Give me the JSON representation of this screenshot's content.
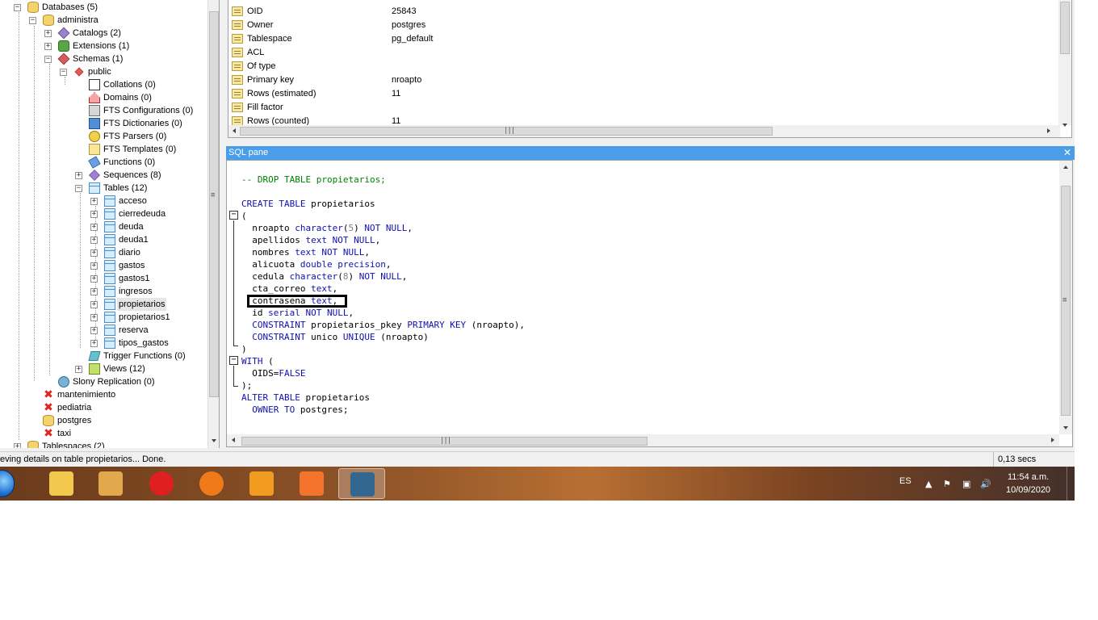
{
  "tree": {
    "databases": "Databases (5)",
    "administra": "administra",
    "catalogs": "Catalogs (2)",
    "extensions": "Extensions (1)",
    "schemas": "Schemas (1)",
    "public": "public",
    "collations": "Collations (0)",
    "domains": "Domains (0)",
    "fts_configurations": "FTS Configurations (0)",
    "fts_dictionaries": "FTS Dictionaries (0)",
    "fts_parsers": "FTS Parsers (0)",
    "fts_templates": "FTS Templates (0)",
    "functions": "Functions (0)",
    "sequences": "Sequences (8)",
    "tables_label": "Tables (12)",
    "tables": [
      "acceso",
      "cierredeuda",
      "deuda",
      "deuda1",
      "diario",
      "gastos",
      "gastos1",
      "ingresos",
      "propietarios",
      "propietarios1",
      "reserva",
      "tipos_gastos"
    ],
    "selected_table": "propietarios",
    "trigger_functions": "Trigger Functions (0)",
    "views": "Views (12)",
    "slony": "Slony Replication (0)",
    "other_dbs": [
      "mantenimiento",
      "pediatria",
      "postgres",
      "taxi"
    ],
    "tablespaces": "Tablespaces (2)"
  },
  "properties": {
    "rows": [
      {
        "name": "OID",
        "value": "25843"
      },
      {
        "name": "Owner",
        "value": "postgres"
      },
      {
        "name": "Tablespace",
        "value": "pg_default"
      },
      {
        "name": "ACL",
        "value": ""
      },
      {
        "name": "Of type",
        "value": ""
      },
      {
        "name": "Primary key",
        "value": "nroapto"
      },
      {
        "name": "Rows (estimated)",
        "value": "11"
      },
      {
        "name": "Fill factor",
        "value": ""
      },
      {
        "name": "Rows (counted)",
        "value": "11"
      }
    ]
  },
  "sql_pane": {
    "title": "SQL pane",
    "close_glyph": "✕",
    "lines": [
      {
        "parts": [
          {
            "t": "-- DROP TABLE propietarios;",
            "c": "cm"
          }
        ]
      },
      {
        "parts": []
      },
      {
        "parts": [
          {
            "t": "CREATE TABLE",
            "c": "kw"
          },
          {
            "t": " propietarios",
            "c": ""
          }
        ]
      },
      {
        "parts": [
          {
            "t": "(",
            "c": ""
          }
        ]
      },
      {
        "parts": [
          {
            "t": "  nroapto ",
            "c": ""
          },
          {
            "t": "character",
            "c": "kw"
          },
          {
            "t": "(",
            "c": ""
          },
          {
            "t": "5",
            "c": "nm"
          },
          {
            "t": ") ",
            "c": ""
          },
          {
            "t": "NOT NULL",
            "c": "kw"
          },
          {
            "t": ",",
            "c": ""
          }
        ]
      },
      {
        "parts": [
          {
            "t": "  apellidos ",
            "c": ""
          },
          {
            "t": "text",
            "c": "kw"
          },
          {
            "t": " ",
            "c": ""
          },
          {
            "t": "NOT NULL",
            "c": "kw"
          },
          {
            "t": ",",
            "c": ""
          }
        ]
      },
      {
        "parts": [
          {
            "t": "  nombres ",
            "c": ""
          },
          {
            "t": "text",
            "c": "kw"
          },
          {
            "t": " ",
            "c": ""
          },
          {
            "t": "NOT NULL",
            "c": "kw"
          },
          {
            "t": ",",
            "c": ""
          }
        ]
      },
      {
        "parts": [
          {
            "t": "  alicuota ",
            "c": ""
          },
          {
            "t": "double precision",
            "c": "kw"
          },
          {
            "t": ",",
            "c": ""
          }
        ]
      },
      {
        "parts": [
          {
            "t": "  cedula ",
            "c": ""
          },
          {
            "t": "character",
            "c": "kw"
          },
          {
            "t": "(",
            "c": ""
          },
          {
            "t": "8",
            "c": "nm"
          },
          {
            "t": ") ",
            "c": ""
          },
          {
            "t": "NOT NULL",
            "c": "kw"
          },
          {
            "t": ",",
            "c": ""
          }
        ]
      },
      {
        "parts": [
          {
            "t": "  cta_correo ",
            "c": ""
          },
          {
            "t": "text",
            "c": "kw"
          },
          {
            "t": ",",
            "c": ""
          }
        ]
      },
      {
        "parts": [
          {
            "t": "  contrasena ",
            "c": ""
          },
          {
            "t": "text",
            "c": "kw"
          },
          {
            "t": ",",
            "c": ""
          }
        ]
      },
      {
        "parts": [
          {
            "t": "  id ",
            "c": ""
          },
          {
            "t": "serial",
            "c": "kw"
          },
          {
            "t": " ",
            "c": ""
          },
          {
            "t": "NOT NULL",
            "c": "kw"
          },
          {
            "t": ",",
            "c": ""
          }
        ]
      },
      {
        "parts": [
          {
            "t": "  ",
            "c": ""
          },
          {
            "t": "CONSTRAINT",
            "c": "kw"
          },
          {
            "t": " propietarios_pkey ",
            "c": ""
          },
          {
            "t": "PRIMARY KEY",
            "c": "kw"
          },
          {
            "t": " (nroapto),",
            "c": ""
          }
        ]
      },
      {
        "parts": [
          {
            "t": "  ",
            "c": ""
          },
          {
            "t": "CONSTRAINT",
            "c": "kw"
          },
          {
            "t": " unico ",
            "c": ""
          },
          {
            "t": "UNIQUE",
            "c": "kw"
          },
          {
            "t": " (nroapto)",
            "c": ""
          }
        ]
      },
      {
        "parts": [
          {
            "t": ")",
            "c": ""
          }
        ]
      },
      {
        "parts": [
          {
            "t": "WITH",
            "c": "kw"
          },
          {
            "t": " (",
            "c": ""
          }
        ]
      },
      {
        "parts": [
          {
            "t": "  OIDS=",
            "c": ""
          },
          {
            "t": "FALSE",
            "c": "kw"
          }
        ]
      },
      {
        "parts": [
          {
            "t": ");",
            "c": ""
          }
        ]
      },
      {
        "parts": [
          {
            "t": "ALTER TABLE",
            "c": "kw"
          },
          {
            "t": " propietarios",
            "c": ""
          }
        ]
      },
      {
        "parts": [
          {
            "t": "  ",
            "c": ""
          },
          {
            "t": "OWNER TO",
            "c": "kw"
          },
          {
            "t": " postgres;",
            "c": ""
          }
        ]
      }
    ]
  },
  "status": {
    "message": "eving details on table propietarios... Done.",
    "time": "0,13 secs"
  },
  "taskbar": {
    "apps": [
      {
        "name": "explorer-icon",
        "label": "Explorer",
        "color": "#f2c94c"
      },
      {
        "name": "media-player-icon",
        "label": "Media",
        "color": "#e2a94c"
      },
      {
        "name": "opera-icon",
        "label": "Opera",
        "color": "#e02020"
      },
      {
        "name": "firefox-icon",
        "label": "Firefox",
        "color": "#f07a1a"
      },
      {
        "name": "sublime-icon",
        "label": "Sublime",
        "color": "#f29b21"
      },
      {
        "name": "xampp-icon",
        "label": "XAMPP",
        "color": "#f5742d"
      },
      {
        "name": "pgadmin-icon",
        "label": "pgAdmin",
        "color": "#336791"
      }
    ],
    "language": "ES",
    "clock_time": "11:54 a.m.",
    "clock_date": "10/09/2020"
  }
}
